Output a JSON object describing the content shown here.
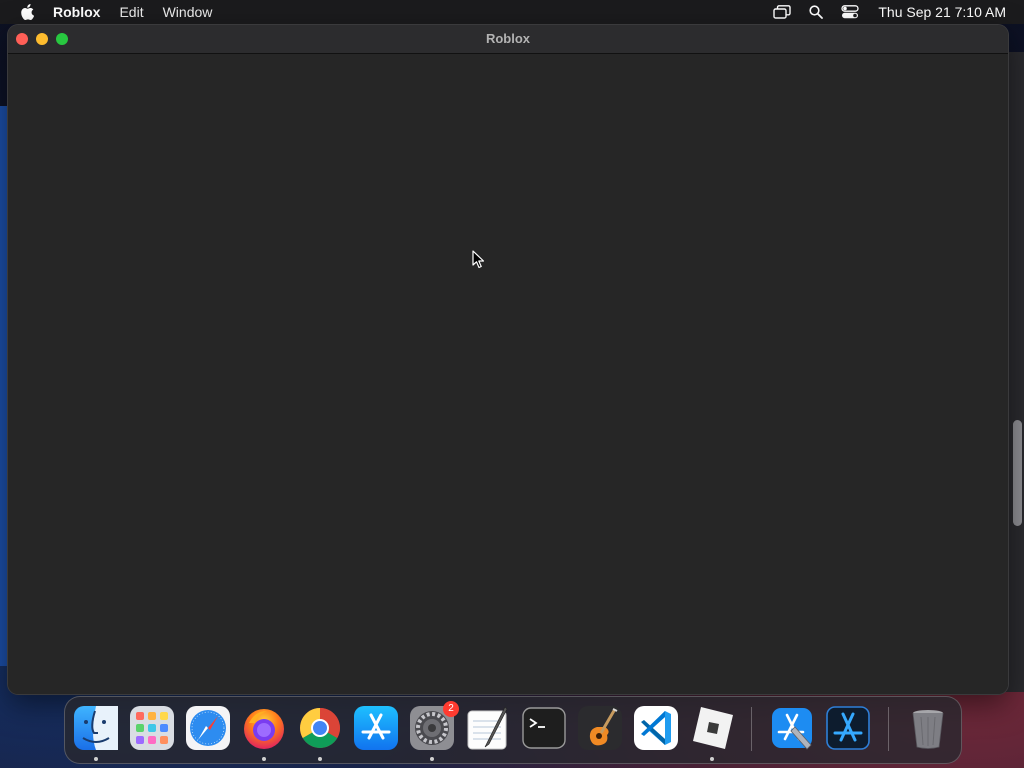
{
  "menubar": {
    "app_name": "Roblox",
    "menus": [
      "Edit",
      "Window"
    ],
    "clock": "Thu Sep 21  7:10 AM",
    "status_icons": [
      "screen-mirroring-icon",
      "spotlight-search-icon",
      "control-center-icon"
    ]
  },
  "window": {
    "title": "Roblox",
    "traffic_lights": {
      "close": "#ff5f57",
      "minimize": "#febc2e",
      "maximize": "#28c840"
    },
    "content_background": "#262626"
  },
  "dock": {
    "items": [
      {
        "name": "finder-icon",
        "running": true
      },
      {
        "name": "launchpad-icon",
        "running": false
      },
      {
        "name": "safari-icon",
        "running": false
      },
      {
        "name": "firefox-icon",
        "running": true
      },
      {
        "name": "chrome-icon",
        "running": true
      },
      {
        "name": "app-store-icon",
        "running": false
      },
      {
        "name": "system-preferences-icon",
        "running": true,
        "badge": "2"
      },
      {
        "name": "textedit-icon",
        "running": false
      },
      {
        "name": "terminal-icon",
        "running": false
      },
      {
        "name": "garageband-icon",
        "running": false
      },
      {
        "name": "vscode-icon",
        "running": false
      },
      {
        "name": "roblox-icon",
        "running": true
      },
      {
        "name": "xcode-icon",
        "running": false
      },
      {
        "name": "instruments-icon",
        "running": false
      },
      {
        "name": "trash-icon",
        "running": false
      }
    ]
  }
}
